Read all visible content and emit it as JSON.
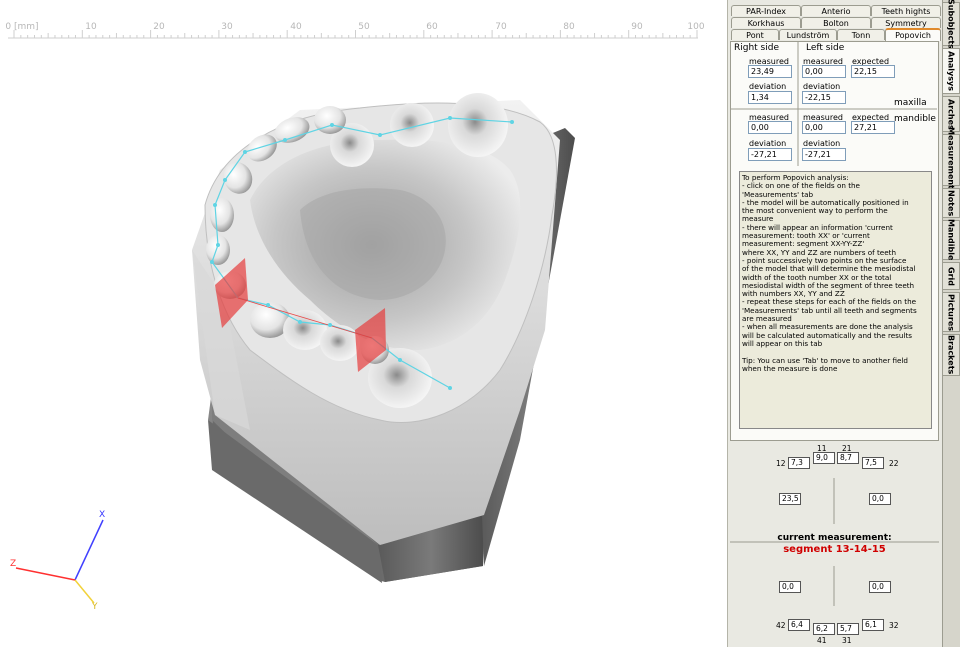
{
  "ruler": {
    "unit_label": "0 [mm]",
    "ticks": [
      "10",
      "20",
      "30",
      "40",
      "50",
      "60",
      "70",
      "80",
      "90",
      "100"
    ]
  },
  "axes_gizmo": {
    "x_label": "X",
    "y_label": "Y",
    "z_label": "Z"
  },
  "top_tabs": {
    "row1": [
      "PAR-Index",
      "Anterio",
      "Teeth hights"
    ],
    "row2": [
      "Korkhaus",
      "Bolton",
      "Symmetry"
    ],
    "row3": [
      "Pont",
      "Lundström",
      "Tonn",
      "Popovich"
    ],
    "active": "Popovich"
  },
  "side_tabs": [
    "Subobjects",
    "Analysys",
    "Arches",
    "Measurements",
    "Notes",
    "Mandible",
    "Grid",
    "Pictures",
    "Brackets"
  ],
  "analysis": {
    "right_side_label": "Right side",
    "left_side_label": "Left side",
    "maxilla_label": "maxilla",
    "mandible_label": "mandible",
    "measured_label": "measured",
    "expected_label": "expected",
    "deviation_label": "deviation",
    "maxilla": {
      "right_measured": "23,49",
      "right_deviation": "1,34",
      "left_measured": "0,00",
      "left_expected": "22,15",
      "left_deviation": "-22,15"
    },
    "mandible": {
      "right_measured": "0,00",
      "right_deviation": "-27,21",
      "left_measured": "0,00",
      "left_expected": "27,21",
      "left_deviation": "-27,21"
    }
  },
  "instructions": {
    "text": "To perform Popovich analysis:\n- click on one of the fields on the\n'Measurements' tab\n- the model will be automatically positioned in\nthe most convenient way to perform the\nmeasure\n- there will appear an information 'current\nmeasurement: tooth XX' or 'current\nmeasurement: segment XX-YY-ZZ'\nwhere XX, YY and ZZ are numbers of teeth\n- point successively two points on the surface\nof the model that will determine the mesiodistal\nwidth of the tooth number XX or the total\nmesiodistal width of the segment of three teeth\nwith numbers XX, YY and ZZ\n- repeat these steps for each of the fields on the\n'Measurements' tab until all teeth and segments\nare measured\n- when all measurements are done the analysis\nwill be calculated automatically and the results\nwill appear on this tab\n\nTip: You can use 'Tab' to move to another field\nwhen the measure is done"
  },
  "tooth_chart": {
    "upper": {
      "n11": "11",
      "n21": "21",
      "n12": "12",
      "n22": "22",
      "t12": "7,3",
      "t11": "9,0",
      "t21": "8,7",
      "t22": "7,5",
      "seg_right": "23,5",
      "seg_left": "0,0"
    },
    "lower": {
      "seg_right": "0,0",
      "seg_left": "0,0",
      "n42": "42",
      "n32": "32",
      "n41": "41",
      "n31": "31",
      "t42": "6,4",
      "t41": "6,2",
      "t31": "5,7",
      "t32": "6,1"
    },
    "current_title": "current measurement:",
    "current_segment": "segment 13-14-15"
  },
  "colors": {
    "accent": "#e08a2c",
    "segment_red": "#d00000",
    "measure_line": "#5fd4e4",
    "plane_red": "#e63c3c"
  }
}
